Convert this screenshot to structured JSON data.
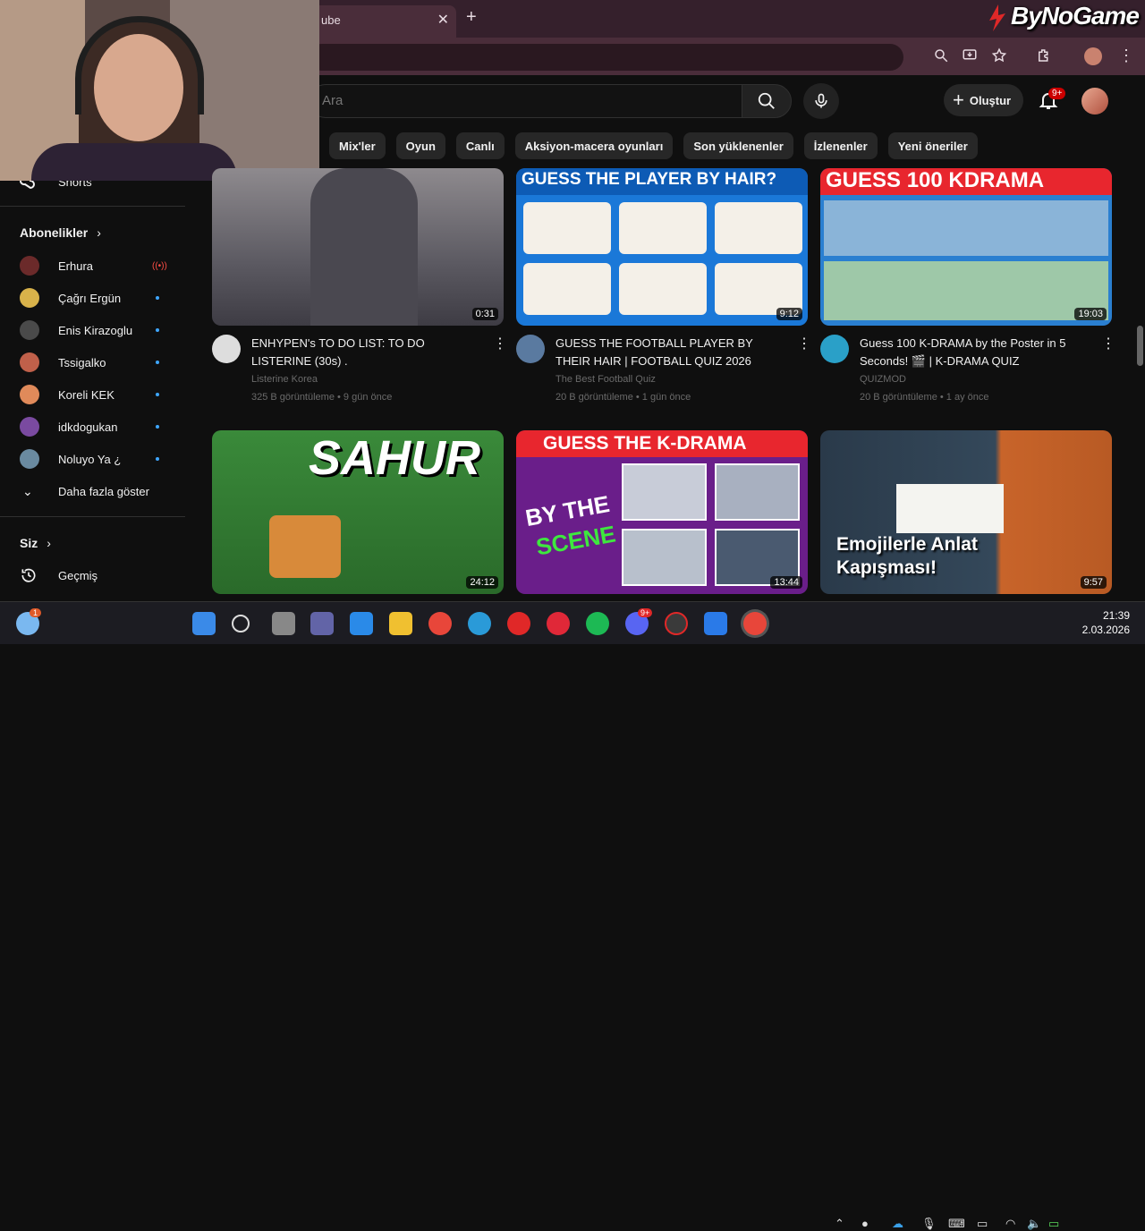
{
  "browser": {
    "tab_title": "ube",
    "tab_close": "✕",
    "new_tab": "+",
    "watermark": "ByNoGame"
  },
  "header": {
    "search_placeholder": "Ara",
    "create_label": "Oluştur",
    "notifications_badge": "9+"
  },
  "chips": [
    "Mix'ler",
    "Oyun",
    "Canlı",
    "Aksiyon-macera oyunları",
    "Son yüklenenler",
    "İzlenenler",
    "Yeni öneriler"
  ],
  "sidebar": {
    "shorts_label": "Shorts",
    "subscriptions_header": "Abonelikler",
    "subscriptions": [
      {
        "name": "Erhura",
        "status": "live",
        "color": "#6b2a2a"
      },
      {
        "name": "Çağrı Ergün",
        "status": "new",
        "color": "#d8b24a"
      },
      {
        "name": "Enis Kirazoglu",
        "status": "new",
        "color": "#4a4a4a"
      },
      {
        "name": "Tssigalko",
        "status": "new",
        "color": "#c0604a"
      },
      {
        "name": "Koreli KEK",
        "status": "new",
        "color": "#e08a5a"
      },
      {
        "name": "idkdogukan",
        "status": "new",
        "color": "#7a4aa0"
      },
      {
        "name": "Noluyo Ya ¿",
        "status": "new",
        "color": "#6a8aa0"
      }
    ],
    "show_more": "Daha fazla göster",
    "you_header": "Siz",
    "history_label": "Geçmiş"
  },
  "videos": [
    {
      "title": "ENHYPEN's TO DO LIST: TO DO LISTERINE (30s) .",
      "channel": "Listerine Korea",
      "meta": "325 B görüntüleme • 9 gün önce",
      "duration": "0:31",
      "thumb_color": "#6e6a6e",
      "overlay": ""
    },
    {
      "title": "GUESS THE FOOTBALL PLAYER BY THEIR HAIR | FOOTBALL QUIZ 2026",
      "channel": "The Best Football Quiz",
      "meta": "20 B görüntüleme • 1 gün önce",
      "duration": "9:12",
      "thumb_color": "#1a78d8",
      "overlay": "GUESS THE PLAYER BY HAIR?"
    },
    {
      "title": "Guess 100 K-DRAMA by the Poster in 5 Seconds! 🎬 | K-DRAMA QUIZ",
      "channel": "QUIZMOD",
      "meta": "20 B görüntüleme • 1 ay önce",
      "duration": "19:03",
      "thumb_color": "#2a7fd0",
      "overlay": "GUESS 100 KDRAMA"
    },
    {
      "title": "",
      "channel": "",
      "meta": "",
      "duration": "24:12",
      "thumb_color": "#3a8a3a",
      "overlay": "SAHUR"
    },
    {
      "title": "",
      "channel": "",
      "meta": "",
      "duration": "13:44",
      "thumb_color": "#6a1e8a",
      "overlay": "GUESS THE K-DRAMA"
    },
    {
      "title": "",
      "channel": "",
      "meta": "",
      "duration": "9:57",
      "thumb_color": "#2a3a4a",
      "overlay": "Emojilerle Anlat Kapışması!"
    }
  ],
  "thumb_extra": {
    "kdrama_by": "BY THE",
    "kdrama_scene": "SCENE"
  },
  "taskbar": {
    "time": "21:39",
    "date": "2.03.2026",
    "weather_badge": "1",
    "discord_badge": "9+"
  }
}
